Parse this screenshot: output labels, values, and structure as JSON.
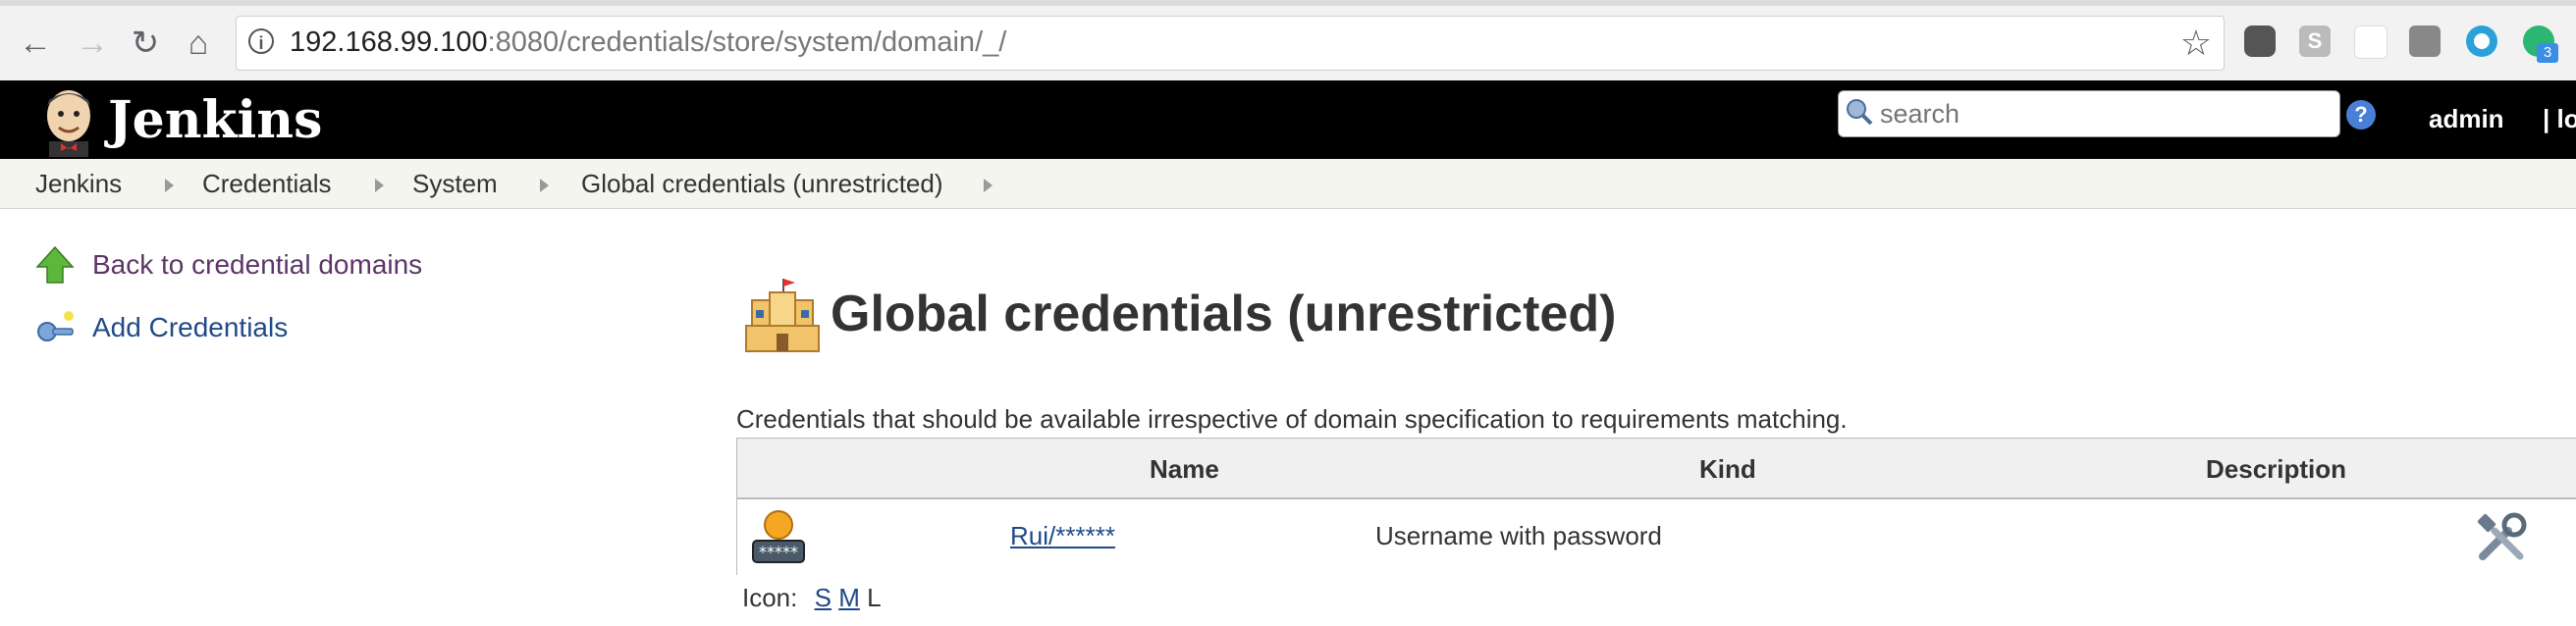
{
  "browser": {
    "url_host": "192.168.99.100",
    "url_rest": ":8080/credentials/store/system/domain/_/",
    "extension_badge": "3"
  },
  "header": {
    "app_name": "Jenkins",
    "search_placeholder": "search",
    "help_label": "?",
    "user": "admin",
    "logout": "| lo"
  },
  "breadcrumbs": [
    "Jenkins",
    "Credentials",
    "System",
    "Global credentials (unrestricted)"
  ],
  "side_panel": {
    "back_label": "Back to credential domains",
    "add_label": "Add Credentials"
  },
  "main": {
    "title": "Global credentials (unrestricted)",
    "description": "Credentials that should be available irrespective of domain specification to requirements matching.",
    "table": {
      "headers": {
        "name": "Name",
        "kind": "Kind",
        "description": "Description"
      },
      "rows": [
        {
          "name": "Rui/******",
          "kind": "Username with password",
          "description": ""
        }
      ]
    },
    "icon_size": {
      "label": "Icon:",
      "small": "S",
      "medium": "M",
      "large": "L"
    }
  },
  "colors": {
    "header_bg": "#000000",
    "breadcrumb_bg": "#f3f5ee",
    "link": "#204a87",
    "visited_link": "#5c3566"
  }
}
